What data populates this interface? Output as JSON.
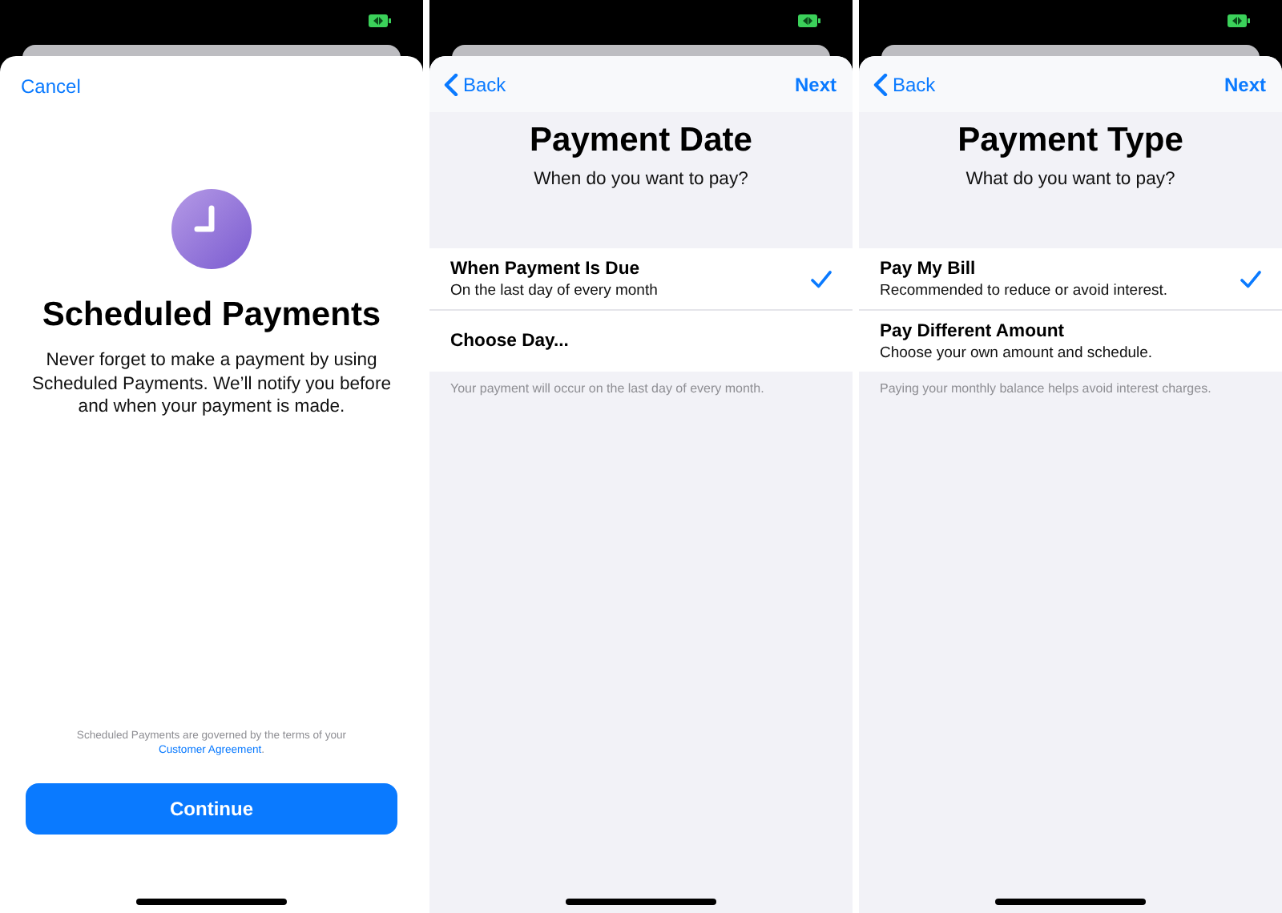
{
  "screens": [
    {
      "kind": "intro",
      "cancel": "Cancel",
      "title": "Scheduled Payments",
      "body": "Never forget to make a payment by using Scheduled Payments. We’ll notify you before and when your payment is made.",
      "footer": "Scheduled Payments are governed by the terms of your",
      "link": "Customer Agreement",
      "footer_end": ".",
      "button": "Continue"
    },
    {
      "kind": "options",
      "back": "Back",
      "next": "Next",
      "title": "Payment Date",
      "subtitle": "When do you want to pay?",
      "options": [
        {
          "title": "When Payment Is Due",
          "subtitle": "On the last day of every month",
          "selected": true
        },
        {
          "title": "Choose Day...",
          "selected": false
        }
      ],
      "note": "Your payment will occur on the last day of every month."
    },
    {
      "kind": "options",
      "back": "Back",
      "next": "Next",
      "title": "Payment Type",
      "subtitle": "What do you want to pay?",
      "options": [
        {
          "title": "Pay My Bill",
          "subtitle": "Recommended to reduce or avoid interest.",
          "selected": true
        },
        {
          "title": "Pay Different Amount",
          "subtitle": "Choose your own amount and schedule.",
          "selected": false
        }
      ],
      "note": "Paying your monthly balance helps avoid interest charges."
    }
  ]
}
